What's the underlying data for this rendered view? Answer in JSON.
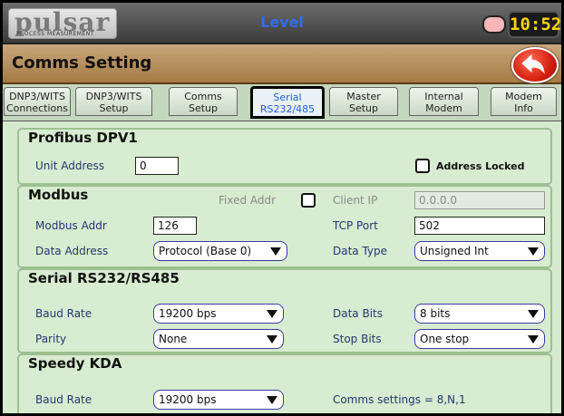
{
  "header": {
    "logo_text": "pulsar",
    "logo_subtext": "PROCESS MEASUREMENT",
    "title": "Level",
    "clock": "10:52"
  },
  "section": {
    "title": "Comms Setting"
  },
  "tabs": [
    {
      "line1": "DNP3/WITS",
      "line2": "Connections"
    },
    {
      "line1": "DNP3/WITS",
      "line2": "Setup"
    },
    {
      "line1": "Comms",
      "line2": "Setup"
    },
    {
      "line1": "Serial",
      "line2": "RS232/485"
    },
    {
      "line1": "Master",
      "line2": "Setup"
    },
    {
      "line1": "Internal",
      "line2": "Modem"
    },
    {
      "line1": "Modem",
      "line2": "Info"
    }
  ],
  "profibus": {
    "title": "Profibus DPV1",
    "unit_address_label": "Unit Address",
    "unit_address_value": "0",
    "address_locked_label": "Address Locked"
  },
  "modbus": {
    "title": "Modbus",
    "fixed_addr_label": "Fixed Addr",
    "client_ip_label": "Client IP",
    "client_ip_value": "0.0.0.0",
    "modbus_addr_label": "Modbus Addr",
    "modbus_addr_value": "126",
    "tcp_port_label": "TCP Port",
    "tcp_port_value": "502",
    "data_address_label": "Data Address",
    "data_address_value": "Protocol (Base 0)",
    "data_type_label": "Data Type",
    "data_type_value": "Unsigned Int"
  },
  "serial": {
    "title": "Serial RS232/RS485",
    "baud_rate_label": "Baud Rate",
    "baud_rate_value": "19200 bps",
    "data_bits_label": "Data Bits",
    "data_bits_value": "8 bits",
    "parity_label": "Parity",
    "parity_value": "None",
    "stop_bits_label": "Stop Bits",
    "stop_bits_value": "One stop"
  },
  "speedy": {
    "title": "Speedy KDA",
    "baud_rate_label": "Baud Rate",
    "baud_rate_value": "19200 bps",
    "comms_settings_text": "Comms settings = 8,N,1"
  },
  "colors": {
    "title_blue": "#2f6df0",
    "clock_yellow": "#ffd400",
    "panel_green": "#d7ecd0",
    "header_tan": "#b38a55",
    "back_red": "#d42010"
  }
}
